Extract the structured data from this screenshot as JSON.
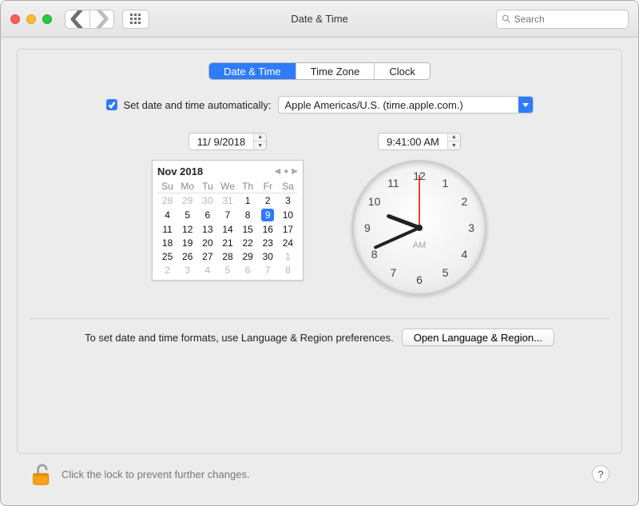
{
  "window": {
    "title": "Date & Time"
  },
  "search": {
    "placeholder": "Search"
  },
  "tabs": {
    "date_time": "Date & Time",
    "time_zone": "Time Zone",
    "clock": "Clock"
  },
  "auto": {
    "label": "Set date and time automatically:",
    "server": "Apple Americas/U.S. (time.apple.com.)",
    "checked": true
  },
  "date_input": "11/  9/2018",
  "time_input": "9:41:00 AM",
  "calendar": {
    "title": "Nov 2018",
    "weekdays": [
      "Su",
      "Mo",
      "Tu",
      "We",
      "Th",
      "Fr",
      "Sa"
    ],
    "weeks": [
      [
        {
          "d": "28",
          "dim": true
        },
        {
          "d": "29",
          "dim": true
        },
        {
          "d": "30",
          "dim": true
        },
        {
          "d": "31",
          "dim": true
        },
        {
          "d": "1"
        },
        {
          "d": "2"
        },
        {
          "d": "3"
        }
      ],
      [
        {
          "d": "4"
        },
        {
          "d": "5"
        },
        {
          "d": "6"
        },
        {
          "d": "7"
        },
        {
          "d": "8"
        },
        {
          "d": "9",
          "sel": true
        },
        {
          "d": "10"
        }
      ],
      [
        {
          "d": "11"
        },
        {
          "d": "12"
        },
        {
          "d": "13"
        },
        {
          "d": "14"
        },
        {
          "d": "15"
        },
        {
          "d": "16"
        },
        {
          "d": "17"
        }
      ],
      [
        {
          "d": "18"
        },
        {
          "d": "19"
        },
        {
          "d": "20"
        },
        {
          "d": "21"
        },
        {
          "d": "22"
        },
        {
          "d": "23"
        },
        {
          "d": "24"
        }
      ],
      [
        {
          "d": "25"
        },
        {
          "d": "26"
        },
        {
          "d": "27"
        },
        {
          "d": "28"
        },
        {
          "d": "29"
        },
        {
          "d": "30"
        },
        {
          "d": "1",
          "dim": true
        }
      ],
      [
        {
          "d": "2",
          "dim": true
        },
        {
          "d": "3",
          "dim": true
        },
        {
          "d": "4",
          "dim": true
        },
        {
          "d": "5",
          "dim": true
        },
        {
          "d": "6",
          "dim": true
        },
        {
          "d": "7",
          "dim": true
        },
        {
          "d": "8",
          "dim": true
        }
      ]
    ]
  },
  "clock": {
    "ampm": "AM",
    "numbers": [
      "12",
      "1",
      "2",
      "3",
      "4",
      "5",
      "6",
      "7",
      "8",
      "9",
      "10",
      "11"
    ]
  },
  "formats_text": "To set date and time formats, use Language & Region preferences.",
  "open_lang_region": "Open Language & Region...",
  "footer_text": "Click the lock to prevent further changes.",
  "help": "?"
}
